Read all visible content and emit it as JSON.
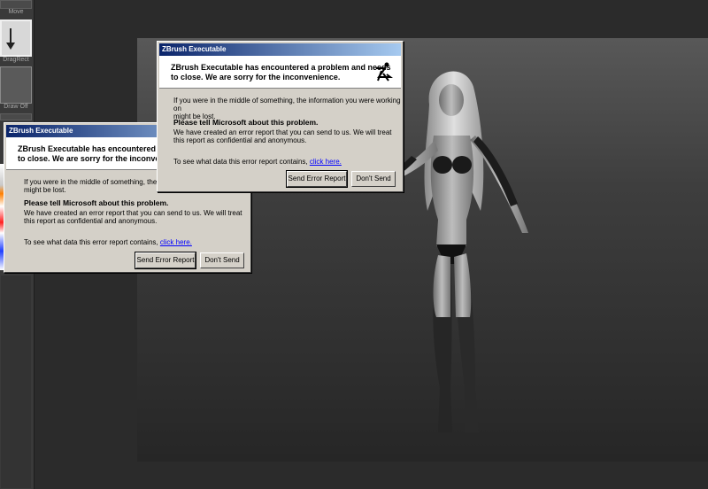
{
  "palette": {
    "move_label": "Move",
    "dragrect_label": "DragRect",
    "draw_off_label": "Draw Off"
  },
  "dialog_back": {
    "title": "ZBrush Executable",
    "heading": "ZBrush Executable has encountered a pr\nto close.  We are sorry for the inconvenie",
    "line1": "If you were in the middle of something, the inform\nmight be lost.",
    "tell_ms": "Please tell Microsoft about this problem.",
    "report_text": "We have created an error report that you can send to us.  We will treat\nthis report as confidential and anonymous.",
    "see_data": "To see what data this error report contains, ",
    "link": "click here.",
    "send_button": "Send Error Report",
    "dont_send_button": "Don't Send"
  },
  "dialog_front": {
    "title": "ZBrush Executable",
    "heading": "ZBrush Executable has encountered a problem and needs\nto close.  We are sorry for the inconvenience.",
    "line1": "If you were in the middle of something, the information you were working on\nmight be lost.",
    "tell_ms": "Please tell Microsoft about this problem.",
    "report_text": "We have created an error report that you can send to us.  We will treat\nthis report as confidential and anonymous.",
    "see_data": "To see what data this error report contains, ",
    "link": "click here.",
    "send_button": "Send Error Report",
    "dont_send_button": "Don't Send"
  }
}
